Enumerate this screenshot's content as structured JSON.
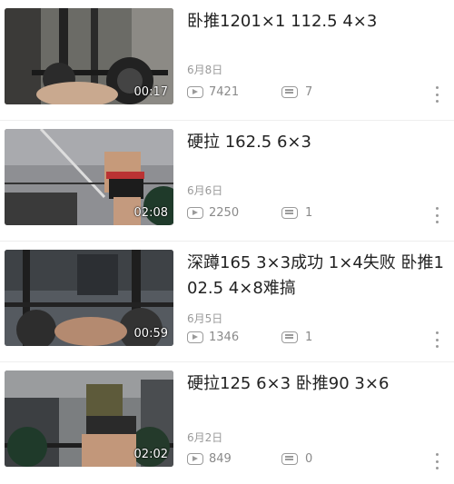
{
  "videos": [
    {
      "title": "卧推1201×1 112.5 4×3",
      "duration": "00:17",
      "date": "6月8日",
      "views": "7421",
      "comments": "7"
    },
    {
      "title": "硬拉 162.5 6×3",
      "duration": "02:08",
      "date": "6月6日",
      "views": "2250",
      "comments": "1"
    },
    {
      "title": "深蹲165 3×3成功 1×4失败 卧推102.5 4×8难搞",
      "duration": "00:59",
      "date": "6月5日",
      "views": "1346",
      "comments": "1"
    },
    {
      "title": "硬拉125 6×3 卧推90 3×6",
      "duration": "02:02",
      "date": "6月2日",
      "views": "849",
      "comments": "0"
    }
  ]
}
